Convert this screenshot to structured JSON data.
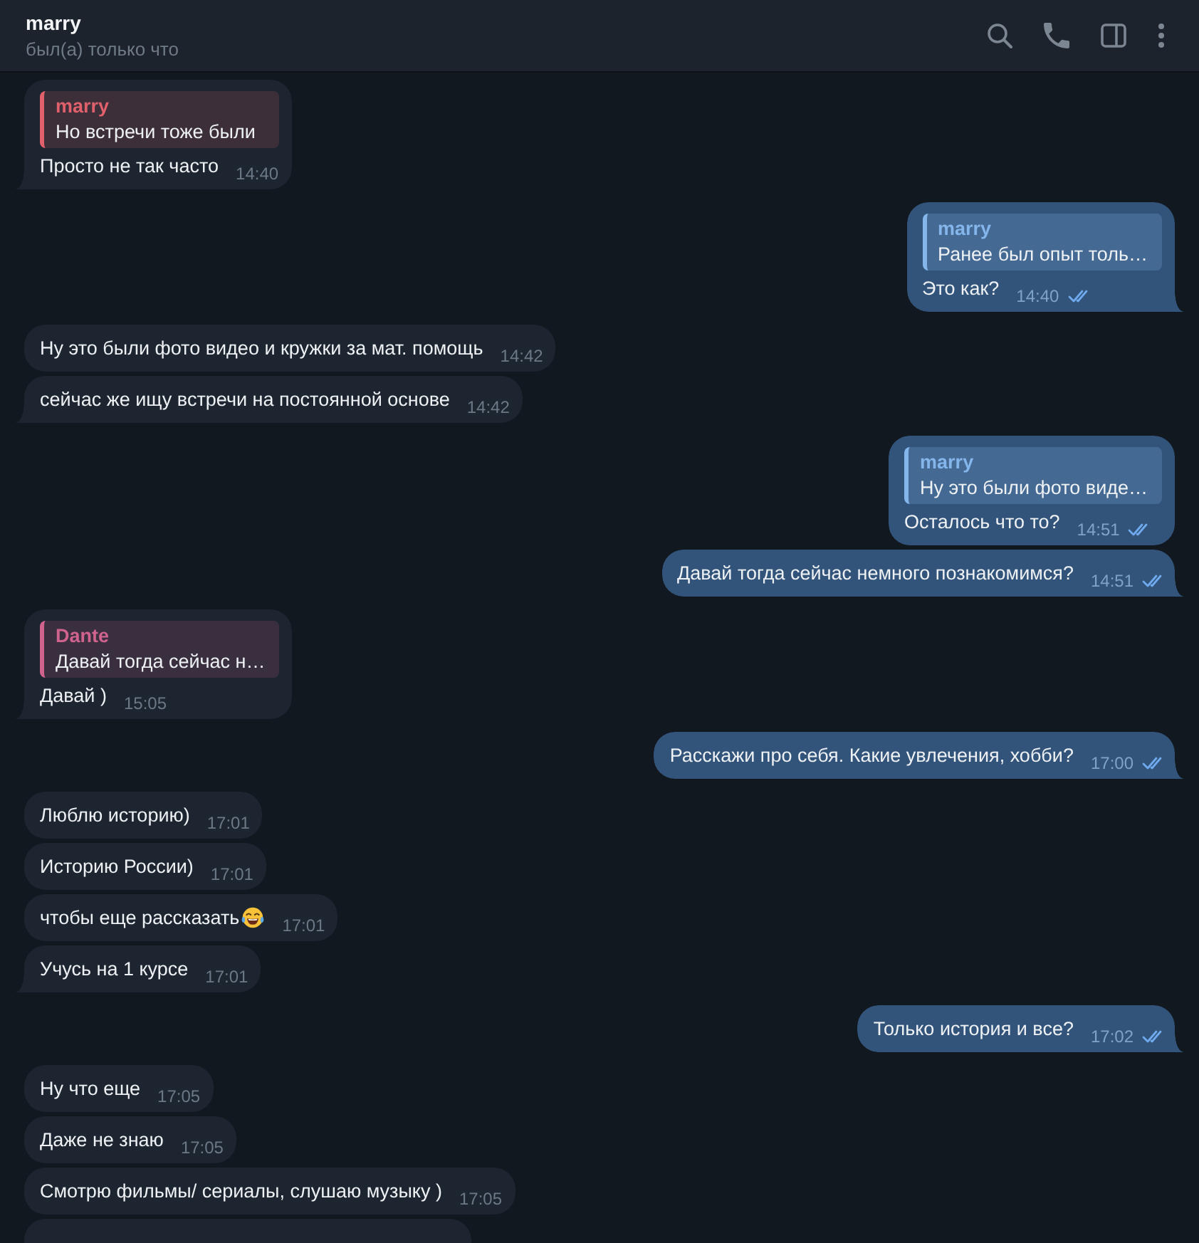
{
  "header": {
    "title": "marry",
    "status": "был(а) только что"
  },
  "groups": [
    {
      "kind": "incoming",
      "messages": [
        {
          "reply": {
            "name": "marry",
            "text": "Но встречи тоже были",
            "color": "#e0616c"
          },
          "text": "Просто не так часто",
          "time": "14:40"
        }
      ]
    },
    {
      "kind": "outgoing",
      "messages": [
        {
          "reply": {
            "name": "marry",
            "text": "Ранее был опыт толь…",
            "color": "#84b6ec"
          },
          "text": "Это как?",
          "time": "14:40",
          "read": true
        }
      ]
    },
    {
      "kind": "incoming",
      "messages": [
        {
          "text": "Ну это были фото видео и кружки за мат. помощь",
          "time": "14:42"
        },
        {
          "text": "сейчас же ищу встречи на постоянной основе",
          "time": "14:42"
        }
      ]
    },
    {
      "kind": "outgoing",
      "messages": [
        {
          "reply": {
            "name": "marry",
            "text": "Ну это были фото виде…",
            "color": "#84b6ec"
          },
          "text": "Осталось что то?",
          "time": "14:51",
          "read": true
        },
        {
          "text": "Давай тогда сейчас немного познакомимся?",
          "time": "14:51",
          "read": true
        }
      ]
    },
    {
      "kind": "incoming",
      "messages": [
        {
          "reply": {
            "name": "Dante",
            "text": "Давай тогда сейчас н…",
            "color": "#d0628e"
          },
          "text": "Давай )",
          "time": "15:05"
        }
      ]
    },
    {
      "kind": "outgoing",
      "messages": [
        {
          "text": "Расскажи про себя. Какие увлечения, хобби?",
          "time": "17:00",
          "read": true
        }
      ]
    },
    {
      "kind": "incoming",
      "messages": [
        {
          "text": "Люблю историю)",
          "time": "17:01"
        },
        {
          "text": "Историю России)",
          "time": "17:01"
        },
        {
          "text": "чтобы еще рассказать",
          "emoji": {
            "kind": "laughing"
          },
          "time": "17:01"
        },
        {
          "text": "Учусь на 1 курсе",
          "time": "17:01"
        }
      ]
    },
    {
      "kind": "outgoing",
      "messages": [
        {
          "text": "Только история и все?",
          "time": "17:02",
          "read": true
        }
      ]
    },
    {
      "kind": "incoming",
      "messages": [
        {
          "text": "Ну что еще",
          "time": "17:05"
        },
        {
          "text": "Даже не знаю",
          "time": "17:05"
        },
        {
          "text": "Смотрю фильмы/ сериалы, слушаю музыку )",
          "time": "17:05"
        }
      ],
      "cut_off_message": true
    }
  ]
}
